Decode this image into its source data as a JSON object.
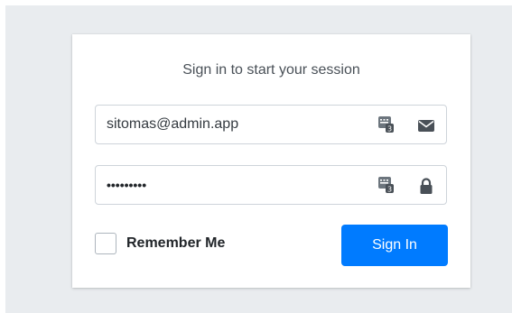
{
  "login": {
    "message": "Sign in to start your session",
    "email": {
      "value": "sitomas@admin.app",
      "icon": "envelope-icon"
    },
    "password": {
      "masked_value": "•••••••••",
      "icon": "lock-icon"
    },
    "password_manager_icon": "password-manager-icon",
    "remember_label": "Remember Me",
    "remember_checked": false,
    "submit_label": "Sign In"
  },
  "colors": {
    "background": "#e9ecef",
    "primary": "#007bff",
    "icon": "#6c757d"
  }
}
